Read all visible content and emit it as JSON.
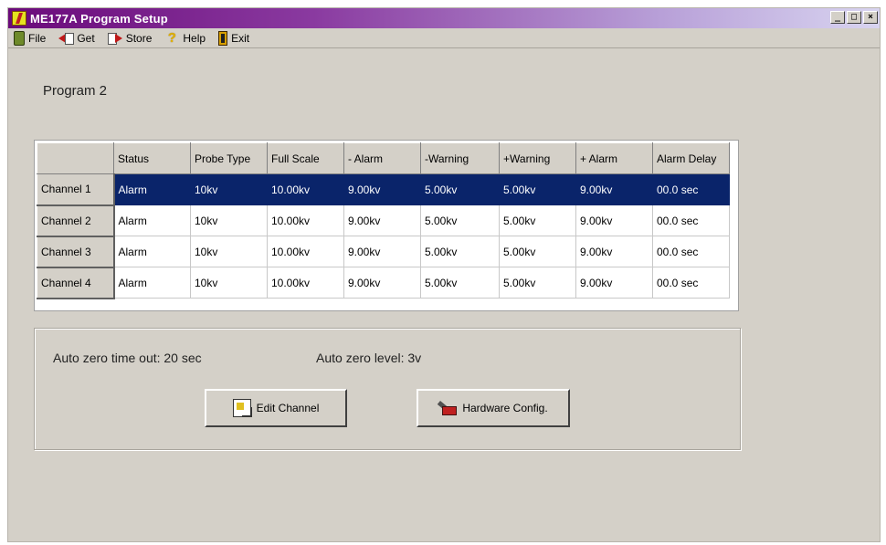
{
  "window": {
    "title": "ME177A Program Setup",
    "controls": {
      "minimize": "_",
      "maximize": "□",
      "close": "×"
    }
  },
  "menu": {
    "items": [
      {
        "label": "File",
        "icon": "file-icon"
      },
      {
        "label": "Get",
        "icon": "get-icon"
      },
      {
        "label": "Store",
        "icon": "store-icon"
      },
      {
        "label": "Help",
        "icon": "help-icon"
      },
      {
        "label": "Exit",
        "icon": "exit-icon"
      }
    ]
  },
  "program": {
    "label": "Program 2"
  },
  "grid": {
    "columns": [
      "Status",
      "Probe Type",
      "Full Scale",
      "- Alarm",
      "-Warning",
      "+Warning",
      "+ Alarm",
      "Alarm Delay"
    ],
    "rows": [
      {
        "header": "Channel 1",
        "selected": true,
        "cells": [
          "Alarm",
          "10kv",
          "10.00kv",
          "9.00kv",
          "5.00kv",
          "5.00kv",
          "9.00kv",
          "00.0 sec"
        ]
      },
      {
        "header": "Channel 2",
        "selected": false,
        "cells": [
          "Alarm",
          "10kv",
          "10.00kv",
          "9.00kv",
          "5.00kv",
          "5.00kv",
          "9.00kv",
          "00.0 sec"
        ]
      },
      {
        "header": "Channel 3",
        "selected": false,
        "cells": [
          "Alarm",
          "10kv",
          "10.00kv",
          "9.00kv",
          "5.00kv",
          "5.00kv",
          "9.00kv",
          "00.0 sec"
        ]
      },
      {
        "header": "Channel 4",
        "selected": false,
        "cells": [
          "Alarm",
          "10kv",
          "10.00kv",
          "9.00kv",
          "5.00kv",
          "5.00kv",
          "9.00kv",
          "00.0 sec"
        ]
      }
    ]
  },
  "settings": {
    "auto_zero_timeout": "Auto zero time out: 20 sec",
    "auto_zero_level": "Auto zero level: 3v"
  },
  "buttons": {
    "edit_channel": "Edit Channel",
    "hardware_config": "Hardware Config."
  },
  "colors": {
    "selection": "#0a246a",
    "face": "#d4d0c8"
  }
}
